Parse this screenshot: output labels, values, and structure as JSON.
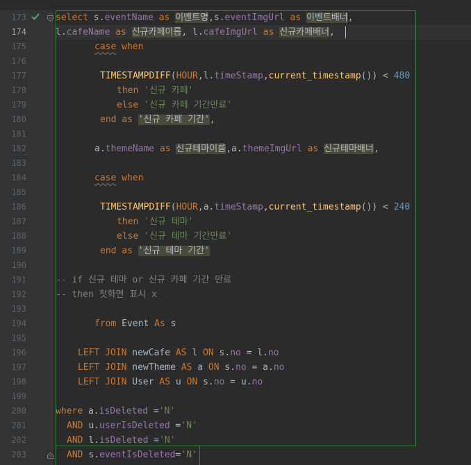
{
  "editor": {
    "current_line_number": "174",
    "line_numbers": [
      "173",
      "174",
      "175",
      "176",
      "177",
      "178",
      "179",
      "180",
      "181",
      "182",
      "183",
      "184",
      "185",
      "186",
      "187",
      "188",
      "189",
      "190",
      "191",
      "192",
      "193",
      "194",
      "195",
      "196",
      "197",
      "198",
      "199",
      "200",
      "201",
      "202",
      "203"
    ]
  },
  "code": {
    "l173": {
      "t1": "select",
      "t2": " s.",
      "t3": "eventName",
      "t4": " as ",
      "t5": "이벤트명",
      "t6": ",s.",
      "t7": "eventImgUrl",
      "t8": " as ",
      "t9": "이벤트배너",
      "t10": ","
    },
    "l174": {
      "t1": "l.",
      "t2": "cafeName",
      "t3": " as ",
      "t4": "신규카페이름",
      "t5": ", l.",
      "t6": "cafeImgUrl",
      "t7": " as ",
      "t8": "신규카페배너",
      "t9": ","
    },
    "l175": {
      "t1": "case",
      "t2": " when"
    },
    "l177": {
      "t1": "TIMESTAMPDIFF",
      "t2": "(",
      "t3": "HOUR",
      "t4": ",l.",
      "t5": "timeStamp",
      "t6": ",",
      "t7": "current_timestamp",
      "t8": "()) < ",
      "t9": "480"
    },
    "l178": {
      "t1": "then ",
      "t2": "'신규 카페'"
    },
    "l179": {
      "t1": "else ",
      "t2": "'신규 카페 기간만료'"
    },
    "l180": {
      "t1": "end as ",
      "t2": "'신규 카페 기간'",
      "t3": ","
    },
    "l182": {
      "t1": "a.",
      "t2": "themeName",
      "t3": " as ",
      "t4": "신규테마이름",
      "t5": ",a.",
      "t6": "themeImgUrl",
      "t7": " as ",
      "t8": "신규테마배너",
      "t9": ","
    },
    "l184": {
      "t1": "case",
      "t2": " when"
    },
    "l186": {
      "t1": "TIMESTAMPDIFF",
      "t2": "(",
      "t3": "HOUR",
      "t4": ",a.",
      "t5": "timeStamp",
      "t6": ",",
      "t7": "current_timestamp",
      "t8": "()) < ",
      "t9": "240"
    },
    "l187": {
      "t1": "then ",
      "t2": "'신규 테마'"
    },
    "l188": {
      "t1": "else ",
      "t2": "'신규 테마 기간만료'"
    },
    "l189": {
      "t1": "end as ",
      "t2": "'신규 테마 기간'"
    },
    "l191": {
      "t1": "-- if 신규 테마 or 신규 카페 기간 만료"
    },
    "l192": {
      "t1": "-- then 첫화면 표시 x"
    },
    "l194": {
      "t1": "from ",
      "t2": "Event ",
      "t3": "As ",
      "t4": "s"
    },
    "l196": {
      "t1": "LEFT JOIN ",
      "t2": "newCafe ",
      "t3": "AS ",
      "t4": "l ",
      "t5": "ON ",
      "t6": "s.",
      "t7": "no",
      "t8": " = l.",
      "t9": "no"
    },
    "l197": {
      "t1": "LEFT JOIN ",
      "t2": "newTheme ",
      "t3": "AS ",
      "t4": "a ",
      "t5": "ON ",
      "t6": "s.",
      "t7": "no",
      "t8": " = a.",
      "t9": "no"
    },
    "l198": {
      "t1": "LEFT JOIN ",
      "t2": "User ",
      "t3": "AS ",
      "t4": "u ",
      "t5": "ON ",
      "t6": "s.",
      "t7": "no",
      "t8": " = u.",
      "t9": "no"
    },
    "l200": {
      "t1": "where ",
      "t2": "a.",
      "t3": "isDeleted",
      "t4": " =",
      "t5": "'N'"
    },
    "l201": {
      "t1": "AND ",
      "t2": "u.",
      "t3": "userIsDeleted",
      "t4": " =",
      "t5": "'N'"
    },
    "l202": {
      "t1": "AND ",
      "t2": "l.",
      "t3": "isDeleted",
      "t4": " =",
      "t5": "'N'"
    },
    "l203": {
      "t1": "AND ",
      "t2": "s.",
      "t3": "eventIsDeleted",
      "t4": "=",
      "t5": "'N'"
    }
  }
}
